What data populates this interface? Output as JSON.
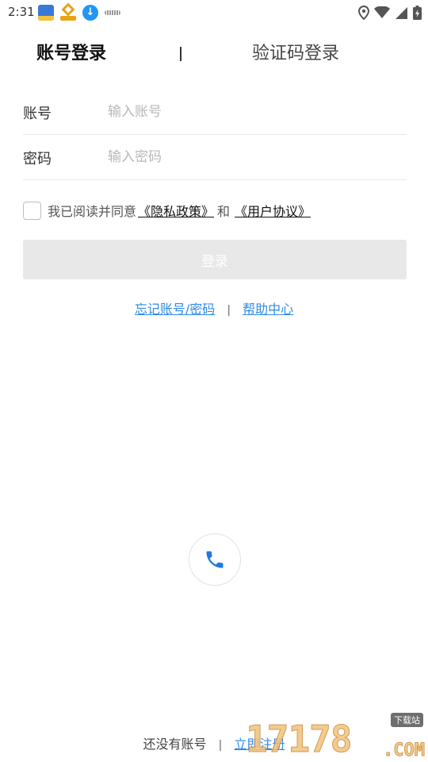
{
  "status_bar": {
    "time": "2:31",
    "notification_icons": [
      "app-icon",
      "app-icon",
      "download-icon",
      "app-icon"
    ],
    "right_icons": [
      "location-icon",
      "wifi-icon",
      "signal-icon",
      "battery-icon"
    ]
  },
  "tabs": {
    "account_login": "账号登录",
    "sms_login": "验证码登录",
    "active": "account_login"
  },
  "form": {
    "account_label": "账号",
    "account_placeholder": "输入账号",
    "account_value": "",
    "password_label": "密码",
    "password_placeholder": "输入密码",
    "password_value": ""
  },
  "agreement": {
    "checked": false,
    "prefix": "我已阅读并同意",
    "privacy_link": "《隐私政策》",
    "and_text": "和",
    "terms_link": "《用户协议》"
  },
  "login_button": {
    "label": "登录"
  },
  "help": {
    "forgot_link": "忘记账号/密码",
    "separator": "|",
    "help_center_link": "帮助中心"
  },
  "phone_button": {
    "icon": "phone-icon"
  },
  "register": {
    "text": "还没有账号",
    "separator": "|",
    "link": "立即注册"
  },
  "watermark": {
    "number": "17178",
    "tag": "下载站",
    "domain": ".COM"
  },
  "colors": {
    "link": "#2f8ae6",
    "button_disabled": "#e8e8e8",
    "phone": "#1f7ae0"
  }
}
